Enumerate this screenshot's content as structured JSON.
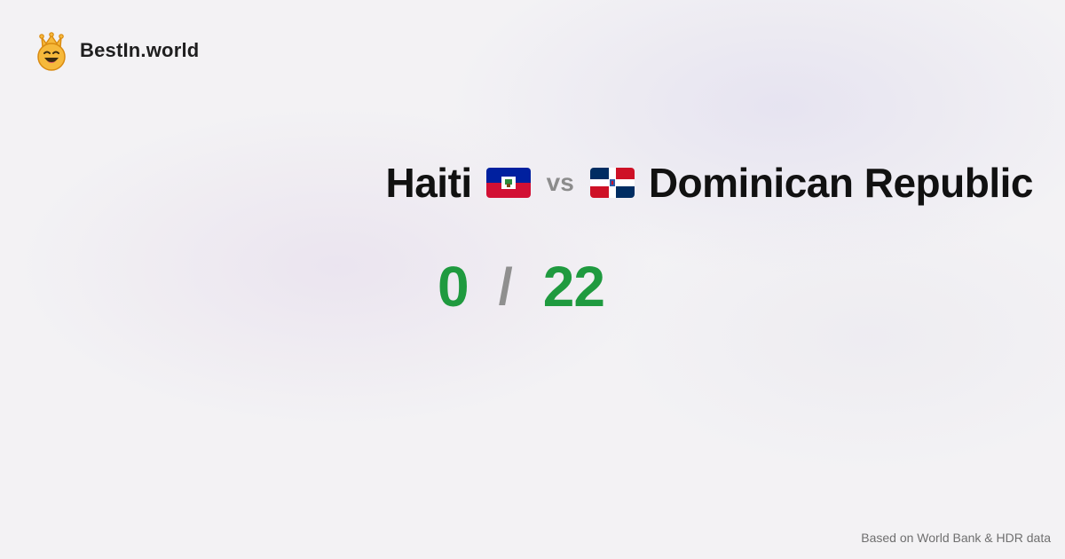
{
  "brand": {
    "name": "BestIn.world",
    "icon": "crowned-smiley-icon",
    "icon_color": "#f6b93b"
  },
  "comparison": {
    "left_country": "Haiti",
    "left_flag": "haiti-flag-icon",
    "vs_label": "vs",
    "right_country": "Dominican Republic",
    "right_flag": "dominican-republic-flag-icon"
  },
  "score": {
    "left": "0",
    "separator": "/",
    "right": "22",
    "color": "#1f9a3f"
  },
  "footer": {
    "source_text": "Based on World Bank & HDR data"
  }
}
